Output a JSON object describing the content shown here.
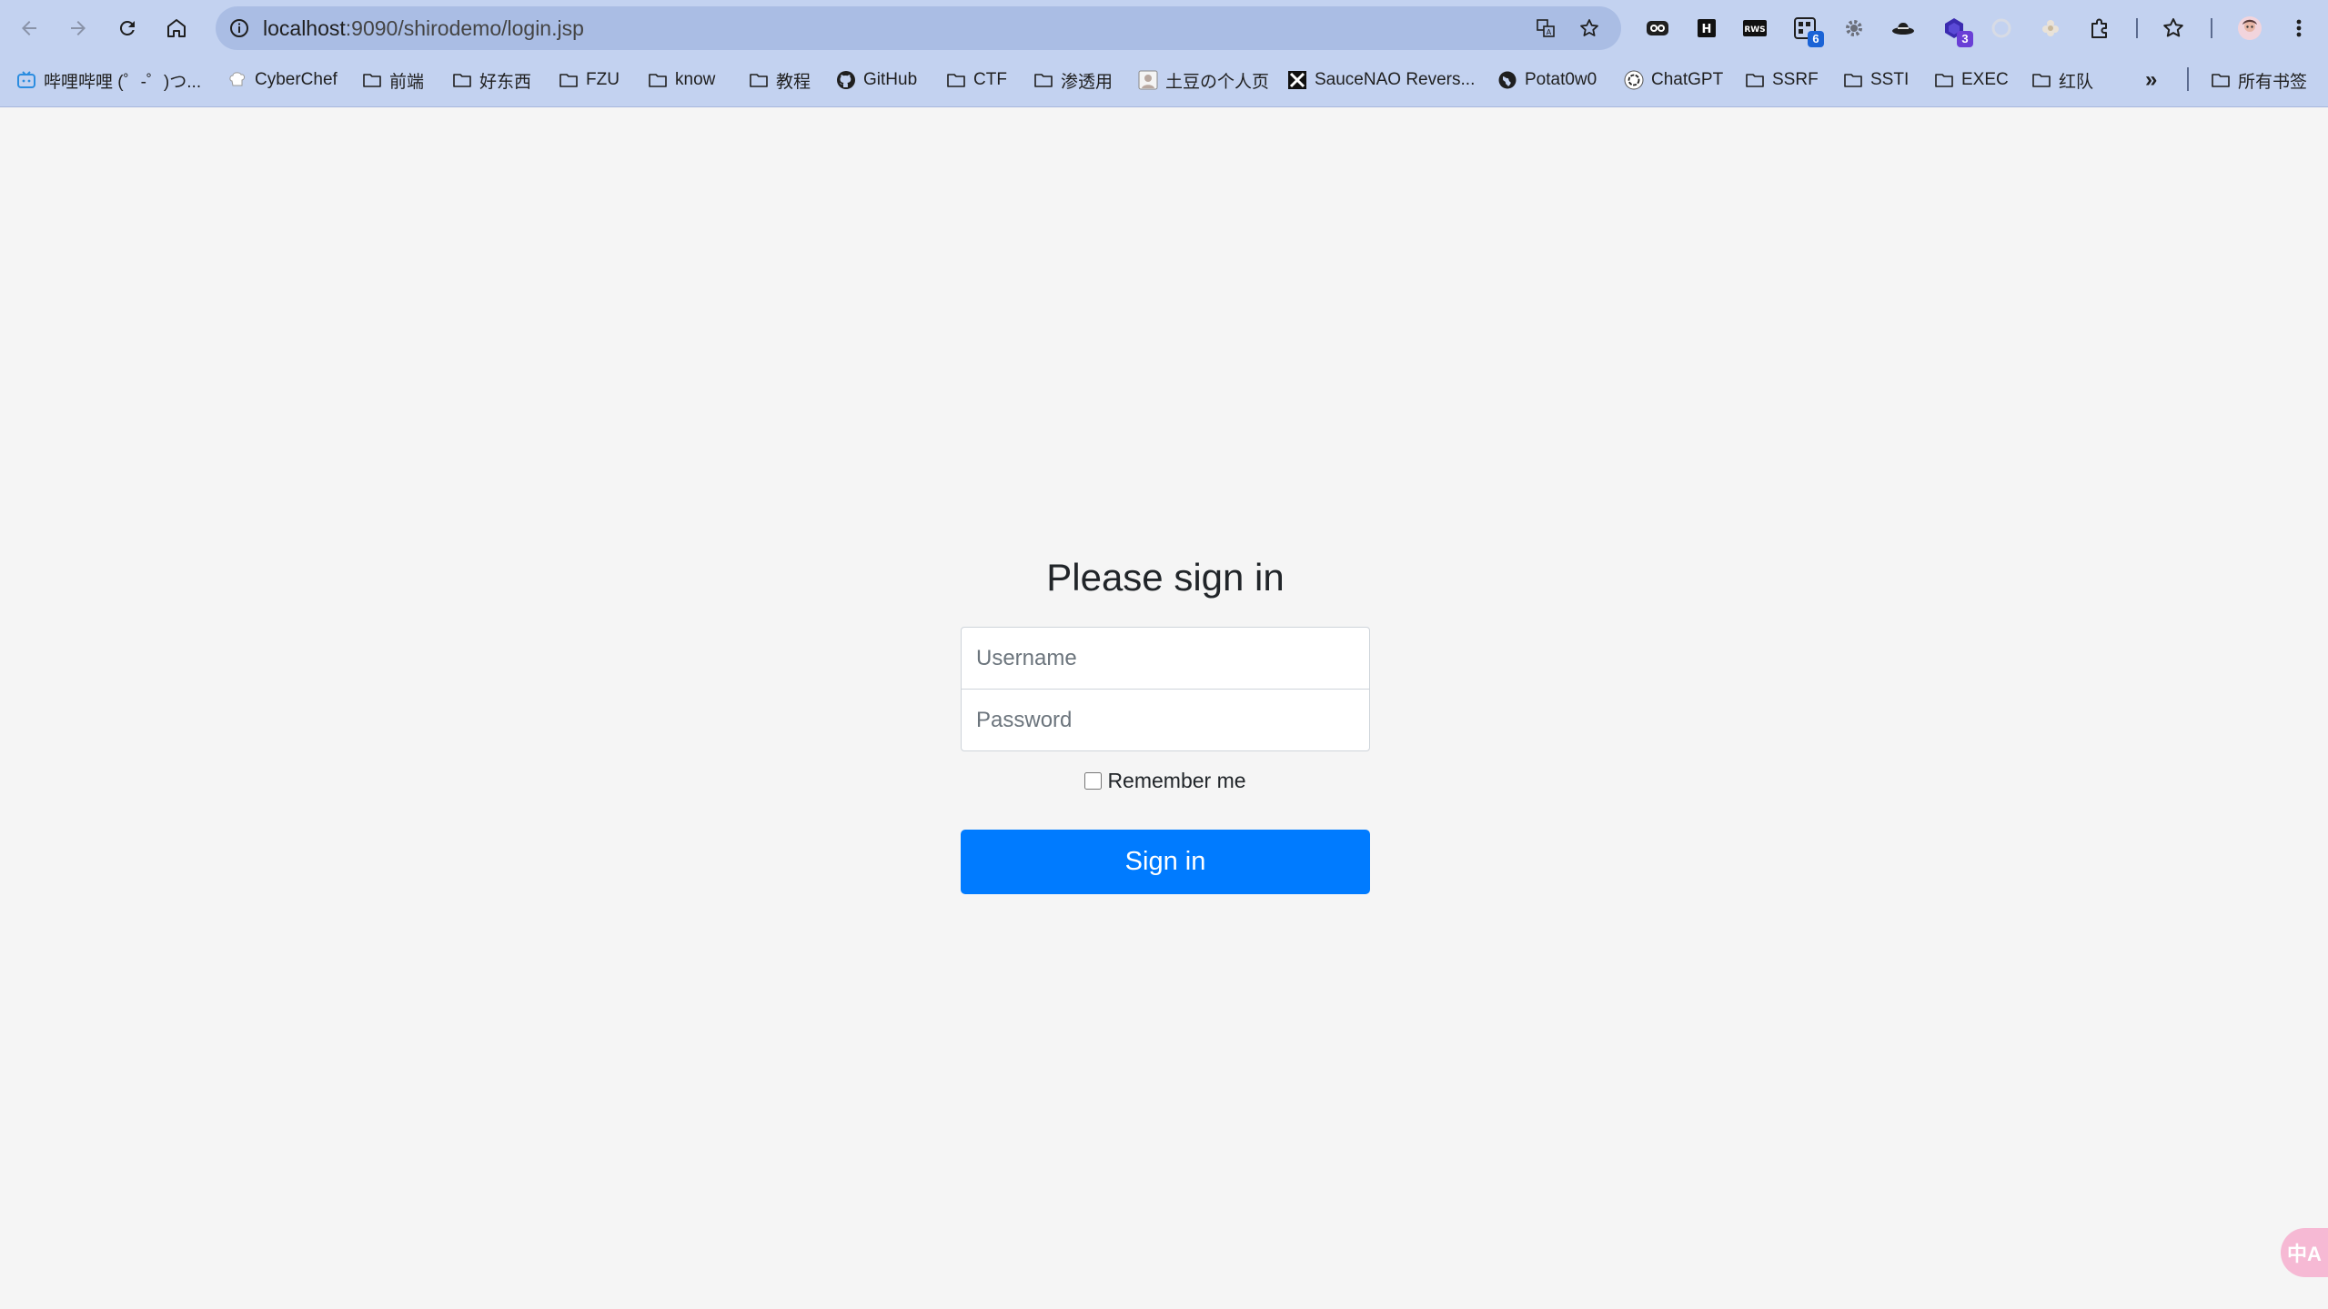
{
  "browser": {
    "url_host": "localhost",
    "url_rest": ":9090/shirodemo/login.jsp",
    "badges": {
      "ext4": "6",
      "ext7": "3"
    },
    "ext_labels": {
      "ext2": "H",
      "ext3": "RWS"
    },
    "bookmarks_more": "»",
    "bookmarks": [
      {
        "label": "哔哩哔哩 (゜-゜)つ...",
        "icon": "bilibili-icon"
      },
      {
        "label": "CyberChef",
        "icon": "cyberchef-icon"
      },
      {
        "label": "前端",
        "icon": "folder-icon"
      },
      {
        "label": "好东西",
        "icon": "folder-icon"
      },
      {
        "label": "FZU",
        "icon": "folder-icon"
      },
      {
        "label": "know",
        "icon": "folder-icon"
      },
      {
        "label": "教程",
        "icon": "folder-icon"
      },
      {
        "label": "GitHub",
        "icon": "github-icon"
      },
      {
        "label": "CTF",
        "icon": "folder-icon"
      },
      {
        "label": "渗透用",
        "icon": "folder-icon"
      },
      {
        "label": "土豆の个人页",
        "icon": "avatar-icon"
      },
      {
        "label": "SauceNAO Revers...",
        "icon": "saucenao-icon"
      },
      {
        "label": "Potat0w0",
        "icon": "globe-icon"
      },
      {
        "label": "ChatGPT",
        "icon": "openai-icon"
      },
      {
        "label": "SSRF",
        "icon": "folder-icon"
      },
      {
        "label": "SSTI",
        "icon": "folder-icon"
      },
      {
        "label": "EXEC",
        "icon": "folder-icon"
      },
      {
        "label": "红队",
        "icon": "folder-icon"
      }
    ],
    "all_bookmarks": "所有书签"
  },
  "login": {
    "heading": "Please sign in",
    "username_placeholder": "Username",
    "password_placeholder": "Password",
    "remember_label": "Remember me",
    "submit_label": "Sign in"
  },
  "floating_button_label": "中A"
}
